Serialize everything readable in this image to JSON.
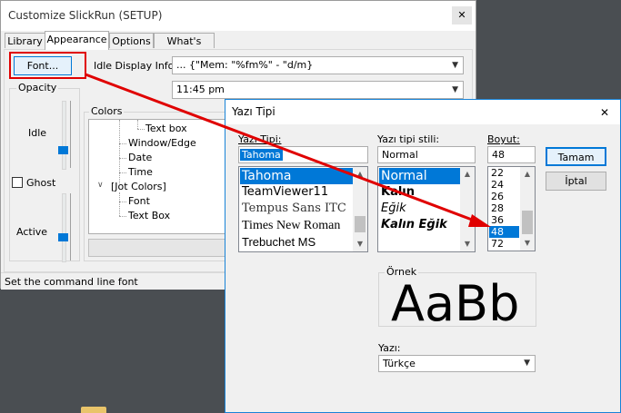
{
  "main_window": {
    "title": "Customize SlickRun (SETUP)",
    "close_glyph": "✕",
    "tabs": [
      "Library",
      "Appearance",
      "Options",
      "What's New"
    ],
    "font_button": "Font...",
    "idle_display_label": "Idle Display Info:",
    "idle_display_value": "... {\"Mem: \"%fm%\" - \"d/m}",
    "time_value": "11:45 pm",
    "opacity": {
      "label": "Opacity",
      "idle_label": "Idle",
      "ghost_label": "Ghost",
      "active_label": "Active"
    },
    "colors": {
      "label": "Colors",
      "tree": [
        "Text box",
        "Window/Edge",
        "Date",
        "Time",
        "[Jot Colors]",
        "Font",
        "Text Box"
      ]
    },
    "status": "Set the command line font"
  },
  "font_dialog": {
    "title": "Yazı Tipi",
    "close_glyph": "✕",
    "font_label": "Yazı Tipi:",
    "font_value": "Tahoma",
    "fonts": [
      "Tahoma",
      "TeamViewer11",
      "Tempus Sans ITC",
      "Times New Roman",
      "Trebuchet MS"
    ],
    "style_label": "Yazı tipi stili:",
    "style_value": "Normal",
    "styles": [
      "Normal",
      "Kalın",
      "Eğik",
      "Kalın Eğik"
    ],
    "size_label": "Boyut:",
    "size_value": "48",
    "sizes": [
      "22",
      "24",
      "26",
      "28",
      "36",
      "48",
      "72"
    ],
    "ok_button": "Tamam",
    "cancel_button": "İptal",
    "sample_label": "Örnek",
    "sample_text": "AaBb",
    "script_label": "Yazı:",
    "script_value": "Türkçe"
  },
  "colors_accent": {
    "selection": "#0078d7",
    "arrow": "#e00000"
  }
}
